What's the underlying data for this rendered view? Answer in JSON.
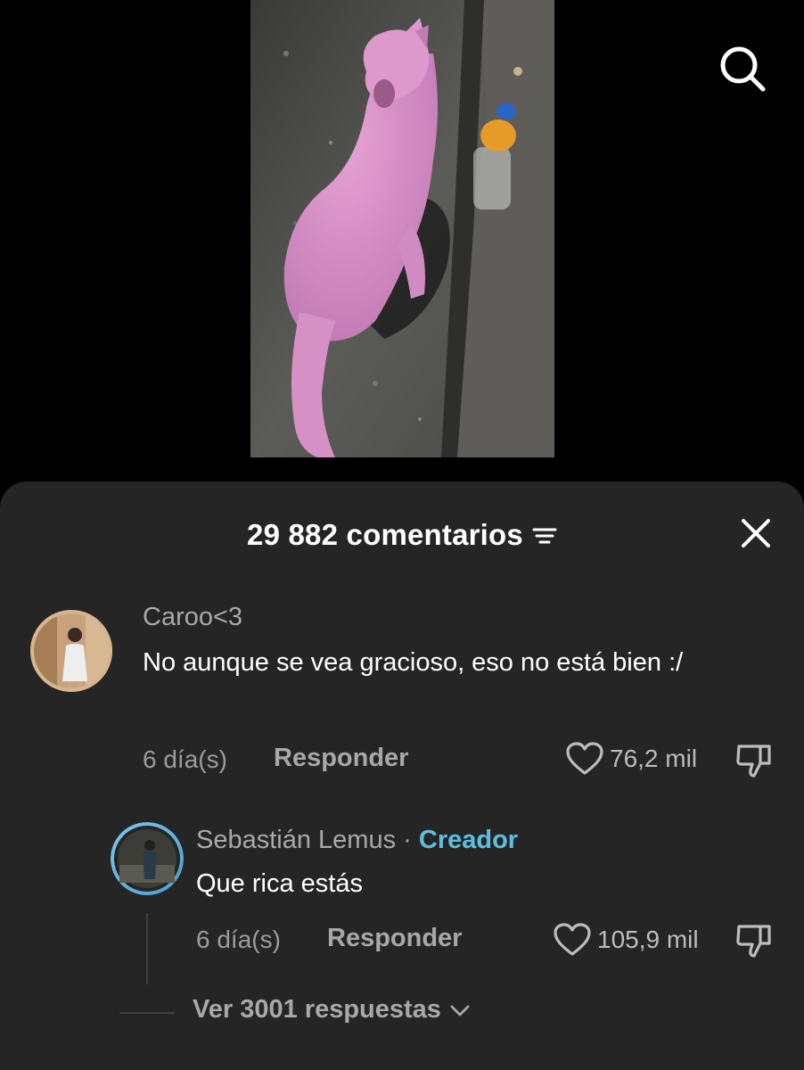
{
  "header": {
    "comment_count": "29 882 comentarios"
  },
  "icons": {
    "search": "search-icon",
    "filter": "filter-icon",
    "close": "close-icon",
    "heart": "heart-icon",
    "dislike": "thumbs-down-icon",
    "chevron": "chevron-down-icon"
  },
  "comments": [
    {
      "username": "Caroo<3",
      "text": "No aunque se vea gracioso, eso no está bien :/",
      "time": "6 día(s)",
      "reply_label": "Responder",
      "likes": "76,2 mil"
    }
  ],
  "reply": {
    "username": "Sebastián Lemus",
    "separator": "·",
    "badge": "Creador",
    "text": "Que rica estás",
    "time": "6 día(s)",
    "reply_label": "Responder",
    "likes": "105,9 mil"
  },
  "view_replies": "Ver 3001 respuestas",
  "colors": {
    "sheet_bg": "#252525",
    "creator_badge": "#5bc0de",
    "video_subject": "#d98fc4"
  }
}
